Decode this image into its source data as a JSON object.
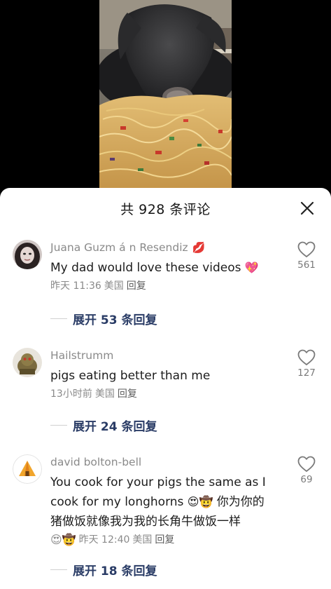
{
  "sheet": {
    "title": "共 928 条评论",
    "close_icon": "close-icon"
  },
  "comments": [
    {
      "username": "Juana Guzm á n Resendiz",
      "username_emoji": "💋",
      "text": "My dad would love these videos",
      "text_emoji": "💖",
      "time": "昨天 11:36",
      "location": "美国",
      "reply_label": "回复",
      "likes": "561",
      "expand_label": "展开 53 条回复"
    },
    {
      "username": "Hailstrumm",
      "text": "pigs eating better than me",
      "time": "13小时前",
      "location": "美国",
      "reply_label": "回复",
      "likes": "127",
      "expand_label": "展开 24 条回复"
    },
    {
      "username": "david bolton-bell",
      "text_line1": "You cook for your pigs the same as I",
      "text_line2a": "cook for my longhorns ",
      "text_line2_emoji": "😍🤠",
      "text_line2b": " 你为你的",
      "text_line3": "猪做饭就像我为我的长角牛做饭一样",
      "text_line4_emoji": "😍🤠",
      "time": "昨天 12:40",
      "location": "美国",
      "reply_label": "回复",
      "likes": "69",
      "expand_label": "展开 18 条回复"
    }
  ],
  "colors": {
    "accent_expand": "#2a3c66",
    "muted": "#8a8a8a",
    "text": "#1c1c1c"
  }
}
